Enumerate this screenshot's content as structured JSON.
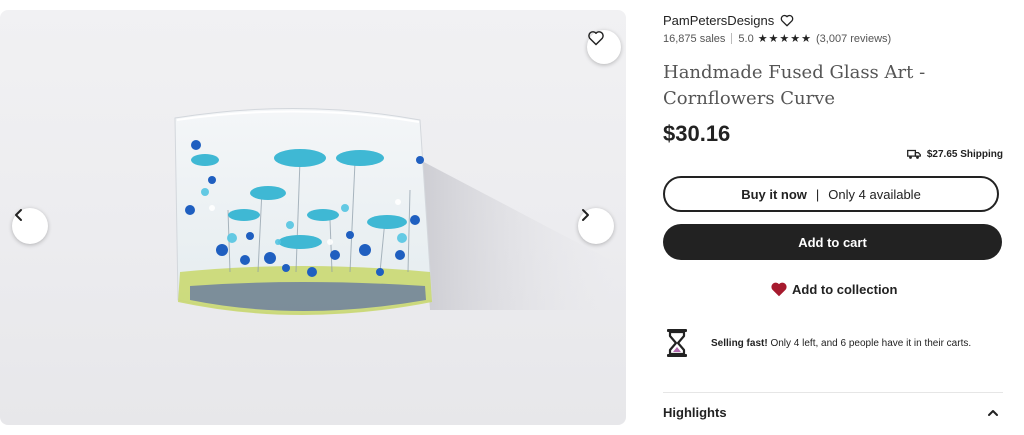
{
  "shop": {
    "name": "PamPetersDesigns",
    "sales": "16,875 sales",
    "rating": "5.0",
    "stars": "★★★★★",
    "reviews": "(3,007 reviews)"
  },
  "listing": {
    "title": "Handmade Fused Glass Art - Cornflowers Curve",
    "price": "$30.16",
    "shipping": "$27.65 Shipping"
  },
  "buttons": {
    "buy_now": "Buy it now",
    "availability": "Only 4 available",
    "separator": "|",
    "add_to_cart": "Add to cart",
    "add_to_collection": "Add to collection"
  },
  "notice": {
    "label": "Selling fast!",
    "text": " Only 4 left, and 6 people have it in their carts."
  },
  "sections": {
    "highlights": "Highlights"
  },
  "icons": {
    "favorite": "heart-outline-icon",
    "prev": "chevron-left-icon",
    "next": "chevron-right-icon",
    "shop_follow": "heart-outline-icon",
    "shipping": "truck-icon",
    "collection": "heart-filled-icon",
    "selling": "hourglass-icon",
    "highlights_toggle": "chevron-up-icon"
  },
  "colors": {
    "primary": "#222222",
    "collection_heart": "#a61a2e",
    "hourglass_accent": "#b26bb0"
  }
}
